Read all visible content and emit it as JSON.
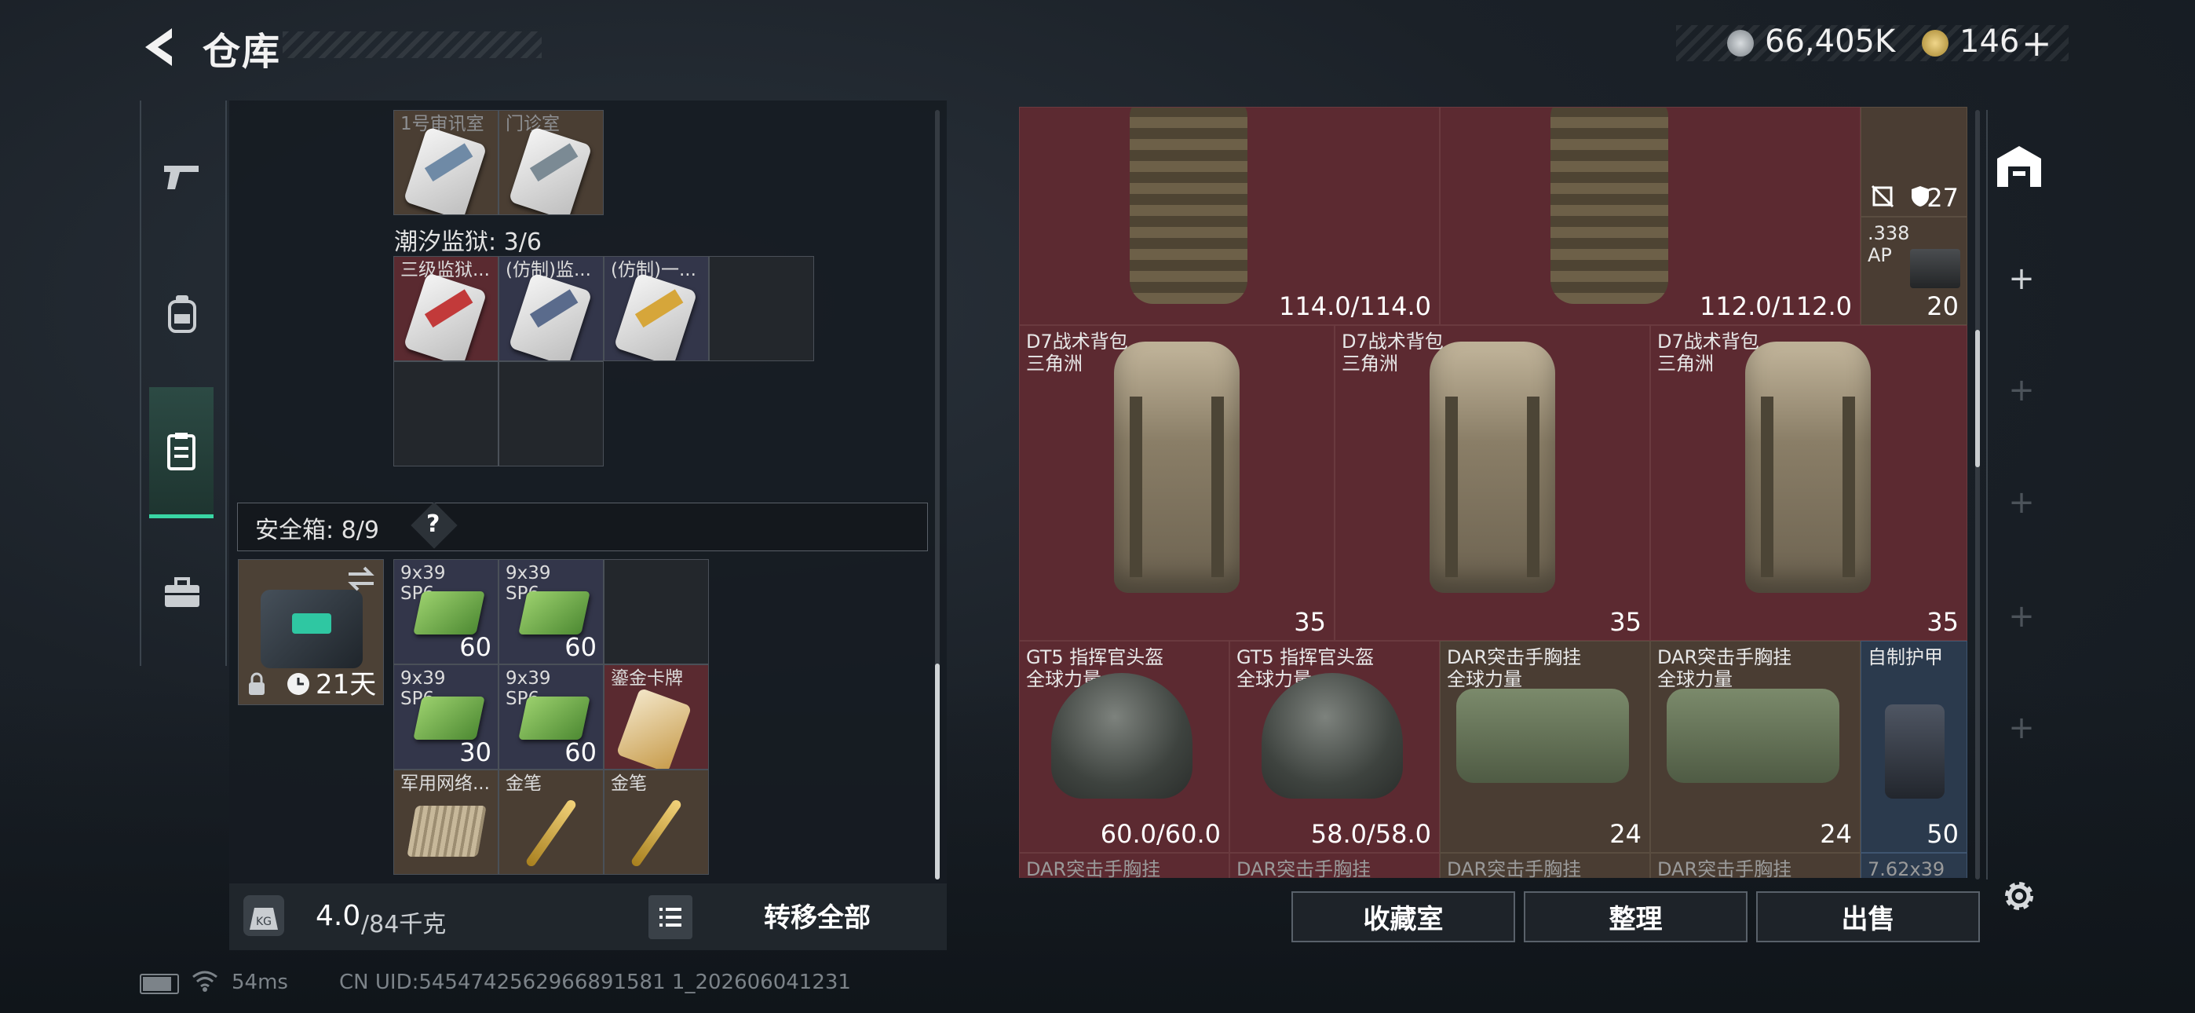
{
  "header": {
    "title": "仓库"
  },
  "currency": {
    "primary": "66,405K",
    "secondary": "146",
    "add": "+"
  },
  "colors": {
    "accent": "#39d6a4",
    "cell_red": "#5c2a31",
    "cell_brown": "#4a3d33",
    "cell_blue": "#2b3a4d"
  },
  "left_tabs": [
    {
      "icon": "pistol-icon"
    },
    {
      "icon": "backpack-icon"
    },
    {
      "icon": "clipboard-icon",
      "active": true
    },
    {
      "icon": "briefcase-icon"
    }
  ],
  "top_cards": [
    {
      "name": "1号审讯室"
    },
    {
      "name": "门诊室"
    }
  ],
  "prison": {
    "label": "潮汐监狱: 3/6",
    "cards": [
      {
        "name": "三级监狱..."
      },
      {
        "name": "(仿制)监..."
      },
      {
        "name": "(仿制)一..."
      }
    ]
  },
  "safebox": {
    "label": "安全箱: 8/9",
    "help": "?",
    "timer": "21天",
    "items": [
      {
        "name": "9x39 SP6",
        "count": "60"
      },
      {
        "name": "9x39 SP6",
        "count": "60"
      },
      {
        "name": "9x39 SP6",
        "count": "30"
      },
      {
        "name": "9x39 SP6",
        "count": "60"
      },
      {
        "name": "鎏金卡牌",
        "count": ""
      },
      {
        "name": "军用网络...",
        "count": ""
      },
      {
        "name": "金笔",
        "count": ""
      },
      {
        "name": "金笔",
        "count": ""
      }
    ]
  },
  "weight": {
    "value": "4.0",
    "max": "/84千克"
  },
  "transfer_all": "转移全部",
  "stash": {
    "vest_left_durability": "114.0/114.0",
    "vest_right_durability": "112.0/112.0",
    "ammo_box": {
      "name": ".338 AP",
      "count": "20"
    },
    "armor_top_value": "27",
    "backpacks": [
      {
        "name": "D7战术背包",
        "faction": "三角洲",
        "value": "35"
      },
      {
        "name": "D7战术背包",
        "faction": "三角洲",
        "value": "35"
      },
      {
        "name": "D7战术背包",
        "faction": "三角洲",
        "value": "35"
      }
    ],
    "row3": [
      {
        "name": "GT5 指挥官头盔",
        "faction": "全球力量",
        "value": "60.0/60.0"
      },
      {
        "name": "GT5 指挥官头盔",
        "faction": "全球力量",
        "value": "58.0/58.0"
      },
      {
        "name": "DAR突击手胸挂",
        "faction": "全球力量",
        "value": "24"
      },
      {
        "name": "DAR突击手胸挂",
        "faction": "全球力量",
        "value": "24"
      },
      {
        "name": "自制护甲",
        "faction": "",
        "value": "50"
      }
    ],
    "row4": [
      "DAR突击手胸挂",
      "DAR突击手胸挂",
      "DAR突击手胸挂",
      "DAR突击手胸挂",
      "7.62x39"
    ]
  },
  "buttons": {
    "collection": "收藏室",
    "organize": "整理",
    "sell": "出售"
  },
  "footer": {
    "ping": "54ms",
    "uid": "CN UID:5454742562966891581 1_202606041231"
  }
}
